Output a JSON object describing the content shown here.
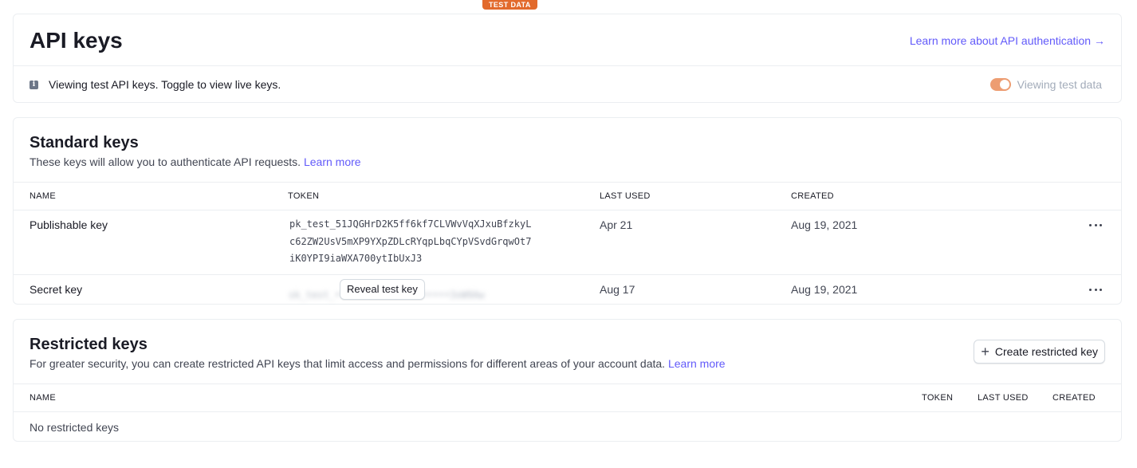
{
  "badge": "TEST DATA",
  "header": {
    "title": "API keys",
    "auth_link": "Learn more about API authentication →",
    "info_icon": "info-icon",
    "info_text": "Viewing test API keys. Toggle to view live keys.",
    "toggle_label": "Viewing test data",
    "toggle_on": true,
    "accent_color": "#625afa",
    "badge_color": "#e26a2c",
    "toggle_color": "#ed9d72"
  },
  "standard": {
    "title": "Standard keys",
    "description": "These keys will allow you to authenticate API requests.",
    "learn_more": "Learn more",
    "columns": [
      "NAME",
      "TOKEN",
      "LAST USED",
      "CREATED"
    ],
    "rows": [
      {
        "name": "Publishable key",
        "token_lines": [
          "pk_test_51JQGHrD2K5ff6kf7CLVWvVqXJxuBfzkyL",
          "c62ZW2UsV5mXP9YXpZDLcRYqpLbqCYpVSvdGrqwOt7",
          "iK0YPI9iaWXA700ytIbUxJ3"
        ],
        "last_used": "Apr 21",
        "created": "Aug 19, 2021",
        "menu_icon": "more-icon"
      },
      {
        "name": "Secret key",
        "token_hidden": "sk_test_••••••••••••••••••••3xW9Aw",
        "reveal_label": "Reveal test key",
        "last_used": "Aug 17",
        "created": "Aug 19, 2021",
        "menu_icon": "more-icon"
      }
    ]
  },
  "restricted": {
    "title": "Restricted keys",
    "description": "For greater security, you can create restricted API keys that limit access and permissions for different areas of your account data.",
    "learn_more": "Learn more",
    "create_button": "Create restricted key",
    "columns": [
      "NAME",
      "TOKEN",
      "LAST USED",
      "CREATED"
    ],
    "empty_text": "No restricted keys"
  }
}
